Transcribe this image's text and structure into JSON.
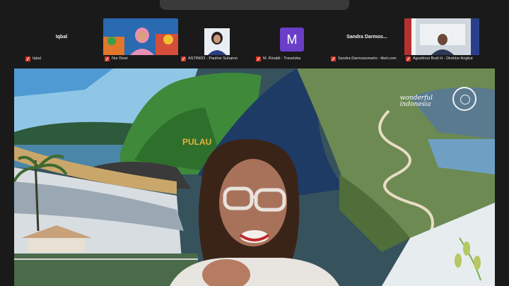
{
  "participants": [
    {
      "name": "Iqbal",
      "label": "Iqbal",
      "video": false
    },
    {
      "name": "Nur Dewi",
      "label": "Nur Dewi",
      "video": true
    },
    {
      "name": "ASTINDO - Pauline Suharno",
      "label": "ASTINDO - Pauline Suharno",
      "video": true
    },
    {
      "name": "M. Rinaldi - Traveloka",
      "label": "M. Rinaldi - Traveloka",
      "avatar_letter": "M",
      "avatar_color": "#6a3ec8"
    },
    {
      "name": "Sandra Darmos...",
      "label": "Sandra Darmosumarto - tiket.com",
      "video": false
    },
    {
      "name": "Agustinus Budi H",
      "label": "Agustinus Budi H - Direktur Angkut",
      "video": true
    }
  ],
  "background": {
    "brand_line1": "wonderful",
    "brand_line2": "indonesia",
    "sign_text": "PULAU"
  },
  "colors": {
    "muted_mic": "#d93a2b",
    "window_bg": "#1a1a1a",
    "topbar": "#3a3a3a"
  }
}
